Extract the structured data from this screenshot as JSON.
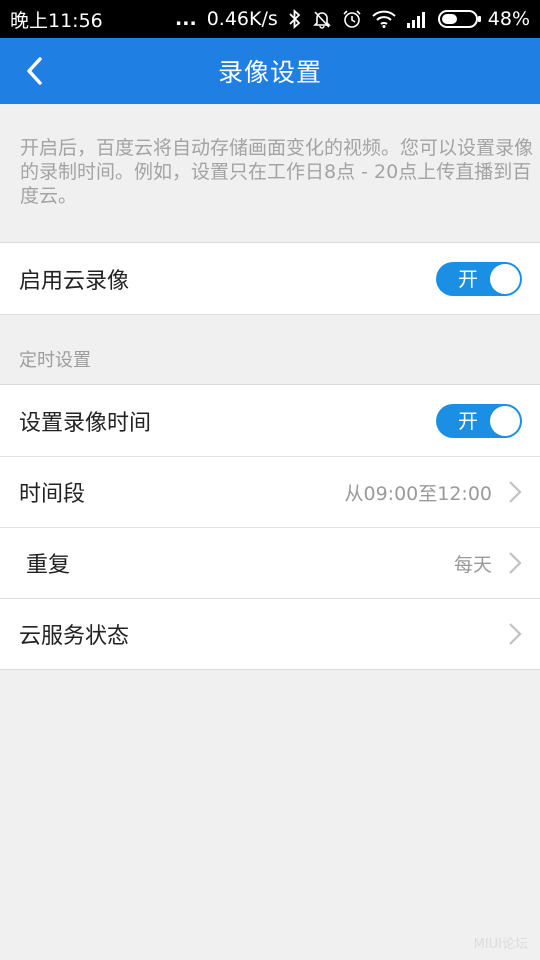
{
  "status_bar": {
    "time": "晚上11:56",
    "dots": "...",
    "network_speed": "0.46K/s",
    "battery_percent": "48%",
    "battery_level": 0.48,
    "icons": [
      "bluetooth-icon",
      "bell-off-icon",
      "alarm-icon",
      "wifi-icon",
      "signal-icon",
      "battery-icon"
    ]
  },
  "header": {
    "title": "录像设置",
    "back_icon": "chevron-left-icon",
    "color": "#1f7fe3"
  },
  "description": "开启后，百度云将自动存储画面变化的视频。您可以设置录像的录制时间。例如，设置只在工作日8点 - 20点上传直播到百度云。",
  "cloud_record": {
    "label": "启用云录像",
    "toggle_text": "开",
    "enabled": true
  },
  "schedule_section": {
    "title": "定时设置",
    "items": [
      {
        "label": "设置录像时间",
        "type": "toggle",
        "toggle_text": "开",
        "enabled": true
      },
      {
        "label": "时间段",
        "type": "link",
        "value": "从09:00至12:00"
      },
      {
        "label": " 重复",
        "type": "link",
        "value": "每天"
      },
      {
        "label": "云服务状态",
        "type": "link",
        "value": ""
      }
    ]
  },
  "watermark": "MIUI论坛",
  "accent_color": "#1a8fe3"
}
